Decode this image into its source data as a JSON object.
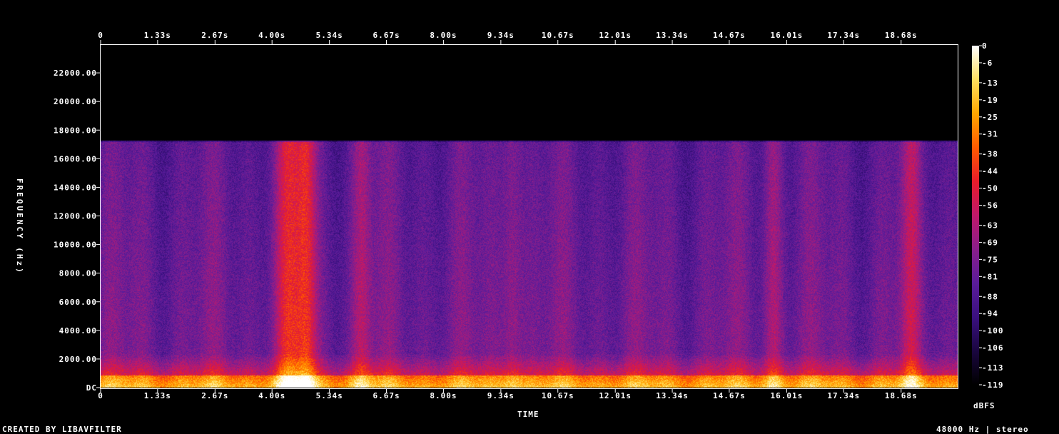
{
  "chart_data": {
    "type": "heatmap",
    "title": "",
    "xlabel": "TIME",
    "ylabel": "FREQUENCY (Hz)",
    "x_unit": "s",
    "y_unit": "Hz",
    "xlim": [
      0,
      20.0
    ],
    "ylim": [
      0,
      24000
    ],
    "x_ticks": [
      "0",
      "1.33s",
      "2.67s",
      "4.00s",
      "5.34s",
      "6.67s",
      "8.00s",
      "9.34s",
      "10.67s",
      "12.01s",
      "13.34s",
      "14.67s",
      "16.01s",
      "17.34s",
      "18.68s"
    ],
    "x_tick_values": [
      0,
      1.33,
      2.67,
      4.0,
      5.34,
      6.67,
      8.0,
      9.34,
      10.67,
      12.01,
      13.34,
      14.67,
      16.01,
      17.34,
      18.68
    ],
    "y_ticks": [
      "DC",
      "2000.00",
      "4000.00",
      "6000.00",
      "8000.00",
      "10000.00",
      "12000.00",
      "14000.00",
      "16000.00",
      "18000.00",
      "20000.00",
      "22000.00"
    ],
    "y_tick_values": [
      0,
      2000,
      4000,
      6000,
      8000,
      10000,
      12000,
      14000,
      16000,
      18000,
      20000,
      22000
    ],
    "content_cutoff_hz": 17300,
    "colorbar": {
      "label": "dBFS",
      "ticks": [
        "0",
        "-6",
        "-13",
        "-19",
        "-25",
        "-31",
        "-38",
        "-44",
        "-50",
        "-56",
        "-63",
        "-69",
        "-75",
        "-81",
        "-88",
        "-94",
        "-100",
        "-106",
        "-113",
        "-119"
      ],
      "min": -119,
      "max": 0,
      "colors": [
        "#000000",
        "#1a0640",
        "#3a1080",
        "#5a1c9a",
        "#8a1e8a",
        "#c0186a",
        "#e81c2a",
        "#ff5a00",
        "#ffa600",
        "#ffe060",
        "#ffffff"
      ]
    },
    "bright_bands_s": [
      4.4,
      4.8,
      6.1,
      9.6,
      15.7,
      18.9
    ]
  },
  "footer": {
    "left": "CREATED BY LIBAVFILTER",
    "right": "48000 Hz | stereo"
  }
}
